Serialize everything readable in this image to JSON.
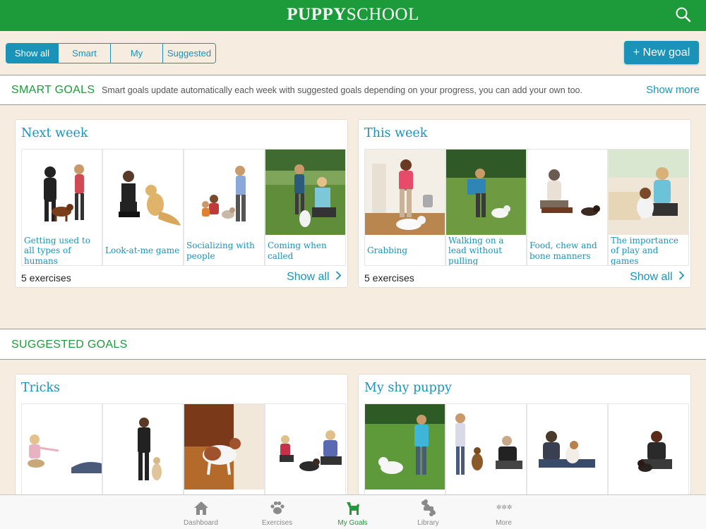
{
  "header": {
    "logo_bold": "PUPPY",
    "logo_light": "SCHOOL"
  },
  "filters": {
    "items": [
      "Show all",
      "Smart",
      "My",
      "Suggested"
    ],
    "active": "Show all"
  },
  "new_goal_label": "+ New goal",
  "smart_goals": {
    "title": "SMART GOALS",
    "description": "Smart goals update automatically each week with suggested goals depending on your progress, you can add your own too.",
    "show_more": "Show more",
    "cards": [
      {
        "title": "Next week",
        "tiles": [
          "Getting used to all types of humans",
          "Look-at-me game",
          "Socializing with people",
          "Coming when called"
        ],
        "count": "5 exercises",
        "link": "Show all"
      },
      {
        "title": "This week",
        "tiles": [
          "Grabbing",
          "Walking on a lead without pulling",
          "Food, chew and bone manners",
          "The importance of play and games"
        ],
        "count": "5 exercises",
        "link": "Show all"
      }
    ]
  },
  "suggested_goals": {
    "title": "SUGGESTED GOALS",
    "cards": [
      {
        "title": "Tricks"
      },
      {
        "title": "My shy puppy"
      }
    ]
  },
  "tabbar": {
    "items": [
      "Dashboard",
      "Exercises",
      "My Goals",
      "Library",
      "More"
    ],
    "active": "My Goals"
  },
  "colors": {
    "brand_green": "#1d9b3a",
    "accent_blue": "#1b93b8",
    "background": "#f6ece0"
  }
}
